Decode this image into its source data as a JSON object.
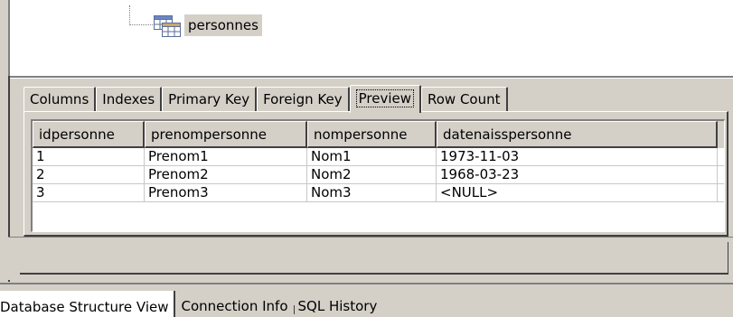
{
  "tree": {
    "node_label": "personnes",
    "node_icon": "table-icon"
  },
  "tabs": [
    {
      "label": "Columns"
    },
    {
      "label": "Indexes"
    },
    {
      "label": "Primary Key"
    },
    {
      "label": "Foreign Key"
    },
    {
      "label": "Preview",
      "active": true
    },
    {
      "label": "Row Count"
    }
  ],
  "grid": {
    "columns": [
      "idpersonne",
      "prenompersonne",
      "nompersonne",
      "datenaisspersonne"
    ],
    "rows": [
      [
        "1",
        "Prenom1",
        "Nom1",
        "1973-11-03"
      ],
      [
        "2",
        "Prenom2",
        "Nom2",
        "1968-03-23"
      ],
      [
        "3",
        "Prenom3",
        "Nom3",
        "<NULL>"
      ]
    ]
  },
  "bottom_tabs": [
    {
      "label": "Database Structure View",
      "active": true
    },
    {
      "label": "Connection Info"
    },
    {
      "label": "SQL History"
    }
  ]
}
